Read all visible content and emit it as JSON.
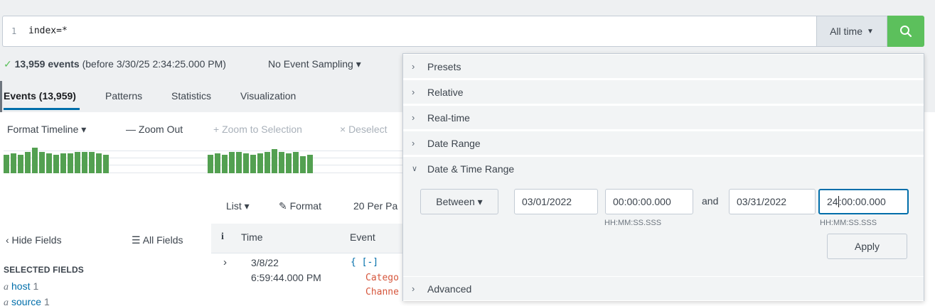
{
  "search": {
    "line_number": "1",
    "query": "index=*",
    "time_picker_label": "All time",
    "submit_icon": "search-icon"
  },
  "status": {
    "check": "✓",
    "count": "13,959 events",
    "before_text": "(before 3/30/25 2:34:25.000 PM)",
    "sampling": "No Event Sampling ▾"
  },
  "tabs": [
    {
      "label": "Events (13,959)"
    },
    {
      "label": "Patterns"
    },
    {
      "label": "Statistics"
    },
    {
      "label": "Visualization"
    }
  ],
  "timeline_toolbar": {
    "format_timeline": "Format Timeline ▾",
    "zoom_out": "— Zoom Out",
    "zoom_to_selection": "+ Zoom to Selection",
    "deselect": "× Deselect"
  },
  "results_toolbar": {
    "list": "List ▾",
    "format": "Format",
    "per_page": "20 Per Pa"
  },
  "fields": {
    "hide_fields": "‹ Hide Fields",
    "all_fields": "All Fields",
    "selected_title": "SELECTED FIELDS",
    "selected": [
      {
        "type": "a",
        "name": "host",
        "count": "1"
      },
      {
        "type": "a",
        "name": "source",
        "count": "1"
      }
    ]
  },
  "table": {
    "headers": {
      "info": "i",
      "time": "Time",
      "event": "Event"
    },
    "rows": [
      {
        "expand": "›",
        "date": "3/8/22",
        "time": "6:59:44.000 PM",
        "json_open": "{ [-]",
        "lines": [
          "Catego",
          "Channe"
        ]
      }
    ]
  },
  "time_dropdown": {
    "sections": [
      {
        "label": "Presets",
        "expanded": false
      },
      {
        "label": "Relative",
        "expanded": false
      },
      {
        "label": "Real-time",
        "expanded": false
      },
      {
        "label": "Date Range",
        "expanded": false
      },
      {
        "label": "Date & Time Range",
        "expanded": true
      },
      {
        "label": "Advanced",
        "expanded": false
      }
    ],
    "range_type": "Between ▾",
    "start_date": "03/01/2022",
    "start_time": "00:00:00.000",
    "and_label": "and",
    "end_date": "03/31/2022",
    "end_time_before_cursor": "24",
    "end_time_after_cursor": ":00:00.000",
    "time_hint": "HH:MM:SS.SSS",
    "apply_label": "Apply"
  },
  "colors": {
    "accent_green": "#5cc05c",
    "link_blue": "#006eaa",
    "timeline_bar": "#53a051",
    "json_key_red": "#d6563c"
  }
}
